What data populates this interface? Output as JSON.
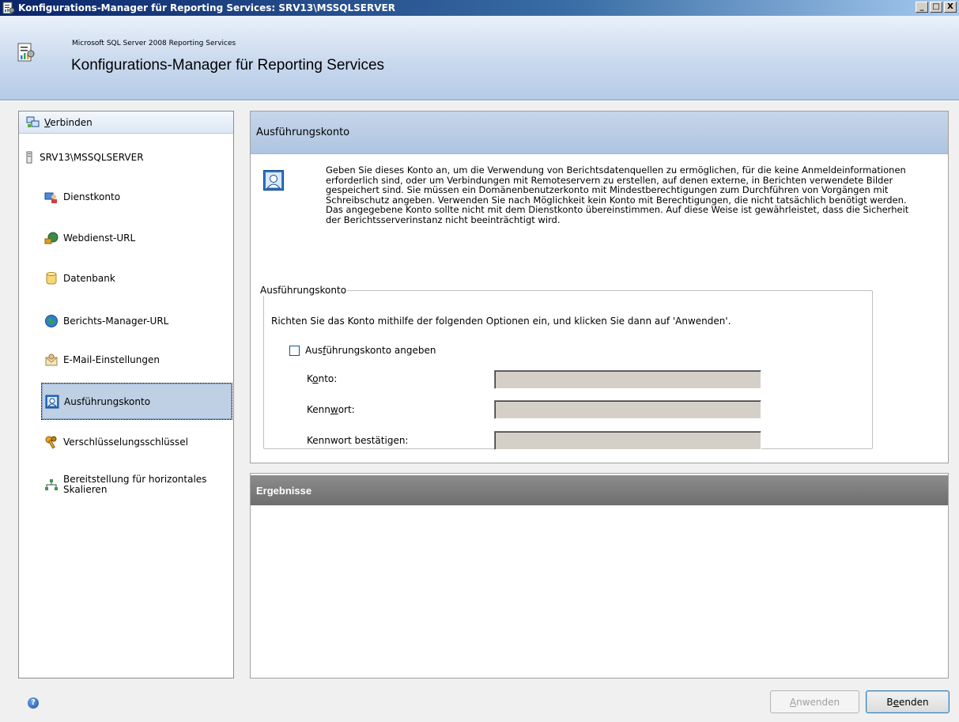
{
  "window": {
    "title": "Konfigurations-Manager für Reporting Services: SRV13\\MSSQLSERVER",
    "controls": [
      "_",
      "□",
      "X"
    ]
  },
  "header": {
    "subtitle": "Microsoft SQL Server 2008 Reporting Services",
    "title": "Konfigurations-Manager für Reporting Services"
  },
  "nav": {
    "connect_label": "erbinden",
    "connect_mnemonic": "V",
    "server": "SRV13\\MSSQLSERVER",
    "items": [
      {
        "label": "Dienstkonto",
        "icon": "service-account-icon"
      },
      {
        "label": "Webdienst-URL",
        "icon": "web-service-icon"
      },
      {
        "label": "Datenbank",
        "icon": "database-icon"
      },
      {
        "label": "Berichts-Manager-URL",
        "icon": "globe-icon"
      },
      {
        "label": "E-Mail-Einstellungen",
        "icon": "email-icon"
      },
      {
        "label": "Ausführungskonto",
        "icon": "execution-account-icon",
        "selected": true
      },
      {
        "label": "Verschlüsselungsschlüssel",
        "icon": "keys-icon"
      },
      {
        "label": "Bereitstellung für horizontales Skalieren",
        "icon": "scaleout-icon"
      }
    ]
  },
  "panel": {
    "title": "Ausführungskonto",
    "description": "Geben Sie dieses Konto an, um die Verwendung von Berichtsdatenquellen zu ermöglichen, für die keine Anmeldeinformationen erforderlich sind, oder um Verbindungen mit Remoteservern zu erstellen, auf denen externe, in Berichten verwendete Bilder gespeichert sind. Sie müssen ein Domänenbenutzerkonto mit Mindestberechtigungen zum Durchführen von Vorgängen mit Schreibschutz angeben. Verwenden Sie nach Möglichkeit kein Konto mit Berechtigungen, die nicht tatsächlich benötigt werden. Das angegebene Konto sollte nicht mit dem Dienstkonto übereinstimmen. Auf diese Weise ist gewährleistet, dass die Sicherheit der Berichtsserverinstanz nicht beeinträchtigt wird.",
    "group_title": "Ausführungskonto",
    "instructions": "Richten Sie das Konto mithilfe der folgenden Optionen ein, und klicken Sie dann auf 'Anwenden'.",
    "checkbox_label_pre": "Aus",
    "checkbox_label_mnemonic": "f",
    "checkbox_label_post": "ührungskonto angeben",
    "checkbox_checked": false,
    "fields": [
      {
        "pre": "K",
        "mnemonic": "o",
        "post": "nto:",
        "value": ""
      },
      {
        "pre": "Kenn",
        "mnemonic": "w",
        "post": "ort:",
        "value": ""
      },
      {
        "pre": "Kennwort bestätigen:",
        "mnemonic": "",
        "post": "",
        "value": ""
      }
    ]
  },
  "results": {
    "title": "Ergebnisse"
  },
  "footer": {
    "help_glyph": "?",
    "apply_mnemonic": "A",
    "apply_rest": "nwenden",
    "exit_pre": "B",
    "exit_mnemonic": "e",
    "exit_post": "enden"
  }
}
